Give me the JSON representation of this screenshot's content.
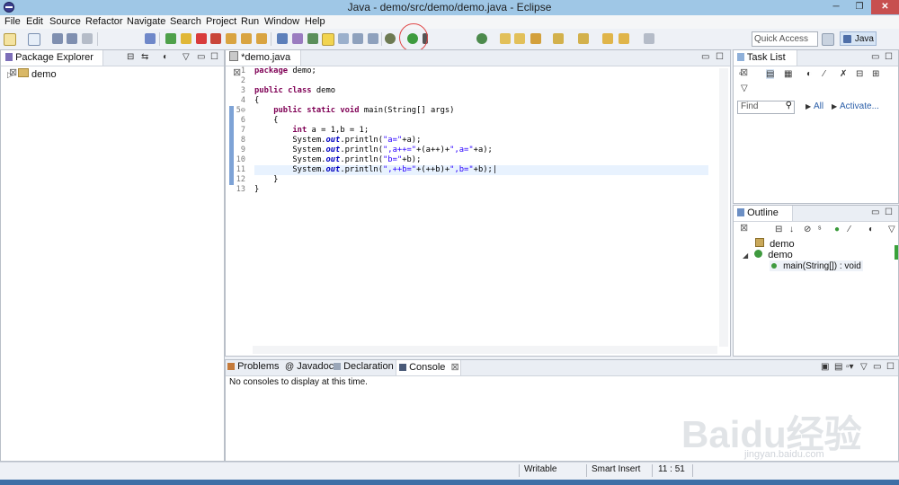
{
  "window": {
    "title": "Java - demo/src/demo/demo.java - Eclipse",
    "minimize": "─",
    "maximize": "❐",
    "close": "✕"
  },
  "menu": [
    "File",
    "Edit",
    "Source",
    "Refactor",
    "Navigate",
    "Search",
    "Project",
    "Run",
    "Window",
    "Help"
  ],
  "toolbar": {
    "quick_access": "Quick Access",
    "perspective": "Java"
  },
  "package_explorer": {
    "tab": "Package Explorer",
    "tree": [
      {
        "label": "demo"
      }
    ]
  },
  "editor": {
    "tab": "*demo.java",
    "lines": [
      {
        "n": "1",
        "html": "<span class='kw'>package</span> demo;"
      },
      {
        "n": "2",
        "html": ""
      },
      {
        "n": "3",
        "html": "<span class='kw'>public class</span> demo"
      },
      {
        "n": "4",
        "html": "{"
      },
      {
        "n": "5⊖",
        "html": "    <span class='kw'>public static void</span> main(String[] args)"
      },
      {
        "n": "6",
        "html": "    {"
      },
      {
        "n": "7",
        "html": "        <span class='kw'>int</span> a = 1,b = 1;"
      },
      {
        "n": "8",
        "html": "        System.<span class='fld'>out</span>.println(<span class='str'>\"a=\"</span>+a);"
      },
      {
        "n": "9",
        "html": "        System.<span class='fld'>out</span>.println(<span class='str'>\",a++=\"</span>+(a++)+<span class='str'>\",a=\"</span>+a);"
      },
      {
        "n": "10",
        "html": "        System.<span class='fld'>out</span>.println(<span class='str'>\"b=\"</span>+b);"
      },
      {
        "n": "11",
        "html": "        System.<span class='fld'>out</span>.println(<span class='str'>\",++b=\"</span>+(++b)+<span class='str'>\",b=\"</span>+b);|"
      },
      {
        "n": "12",
        "html": "    }"
      },
      {
        "n": "13",
        "html": "}"
      }
    ]
  },
  "task_list": {
    "tab": "Task List",
    "find_placeholder": "Find",
    "all": "All",
    "activate": "Activate..."
  },
  "outline": {
    "tab": "Outline",
    "items": [
      {
        "label": "demo"
      },
      {
        "label": "demo"
      },
      {
        "label": "main(String[]) : void"
      }
    ]
  },
  "bottom_panel": {
    "tabs": [
      "Problems",
      "Javadoc",
      "Declaration",
      "Console"
    ],
    "message": "No consoles to display at this time."
  },
  "status": {
    "writable": "Writable",
    "insert_mode": "Smart Insert",
    "position": "11 : 51"
  },
  "watermark": {
    "brand": "Baidu经验",
    "url": "jingyan.baidu.com"
  }
}
